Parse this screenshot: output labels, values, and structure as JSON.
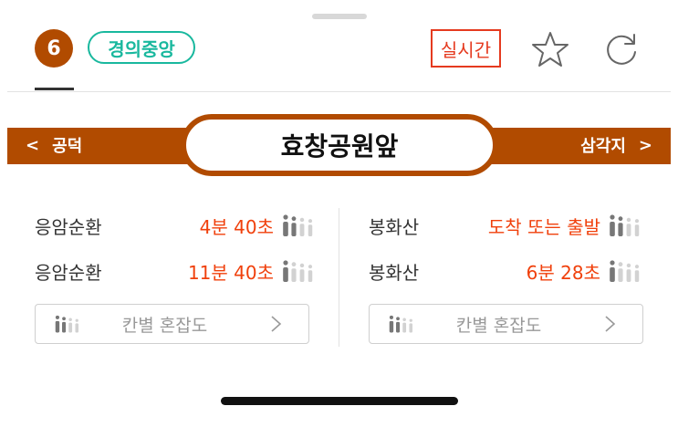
{
  "header": {
    "line_number": "6",
    "line_name": "경의중앙",
    "realtime_label": "실시간",
    "line_color": "#b14b00",
    "line_name_color": "#19b89e",
    "realtime_color": "#e53a1f"
  },
  "station": {
    "prev": "공덕",
    "prev_arrow": "<",
    "current": "효창공원앞",
    "next": "삼각지",
    "next_arrow": ">"
  },
  "arrivals": {
    "left": [
      {
        "destination": "응암순환",
        "time": "4분 40초",
        "crowd_level": 2
      },
      {
        "destination": "응암순환",
        "time": "11분 40초",
        "crowd_level": 1
      }
    ],
    "right": [
      {
        "destination": "봉화산",
        "time": "도착 또는 출발",
        "crowd_level": 2
      },
      {
        "destination": "봉화산",
        "time": "6분 28초",
        "crowd_level": 1
      }
    ]
  },
  "congestion": {
    "left_label": "칸별 혼잡도",
    "right_label": "칸별 혼잡도"
  },
  "icons": [
    "star-icon",
    "refresh-icon",
    "crowd-icon",
    "chevron-right-icon"
  ]
}
